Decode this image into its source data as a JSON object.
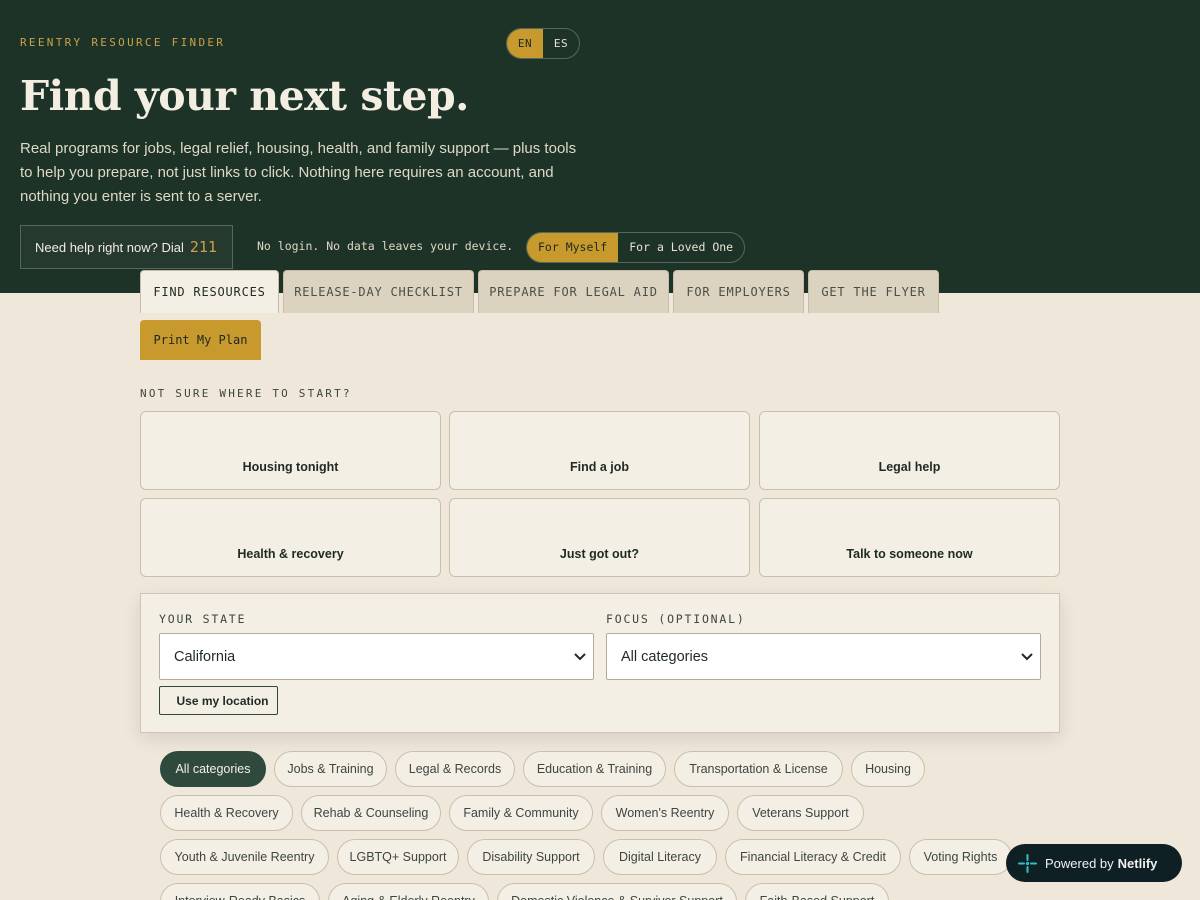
{
  "brand": "REENTRY RESOURCE FINDER",
  "languages": [
    {
      "label": "EN",
      "active": true
    },
    {
      "label": "ES",
      "active": false
    }
  ],
  "hero": {
    "title": "Find your next step.",
    "lead": "Real programs for jobs, legal relief, housing, health, and family support — plus tools to help you prepare, not just links to click. Nothing here requires an account, and nothing you enter is sent to a server."
  },
  "help": {
    "text": "Need help right now? Dial",
    "number": "211"
  },
  "privacy_note": "No login. No data leaves your device.",
  "audience": [
    {
      "label": "For Myself",
      "active": true
    },
    {
      "label": "For a Loved One",
      "active": false
    }
  ],
  "tabs": [
    {
      "label": "FIND RESOURCES",
      "active": true
    },
    {
      "label": "RELEASE-DAY CHECKLIST",
      "active": false
    },
    {
      "label": "PREPARE FOR LEGAL AID",
      "active": false
    },
    {
      "label": "FOR EMPLOYERS",
      "active": false
    },
    {
      "label": "GET THE FLYER",
      "active": false
    }
  ],
  "print_button": "Print My Plan",
  "start_heading": "NOT SURE WHERE TO START?",
  "quick_cards": [
    "Housing tonight",
    "Find a job",
    "Legal help",
    "Health & recovery",
    "Just got out?",
    "Talk to someone now"
  ],
  "filters": {
    "state_label": "YOUR STATE",
    "state_value": "California",
    "focus_label": "FOCUS (OPTIONAL)",
    "focus_value": "All categories",
    "location_button": "Use my location"
  },
  "categories": [
    {
      "label": "All categories",
      "active": true
    },
    {
      "label": "Jobs & Training"
    },
    {
      "label": "Legal & Records"
    },
    {
      "label": "Education & Training"
    },
    {
      "label": "Transportation & License"
    },
    {
      "label": "Housing"
    },
    {
      "label": "Health & Recovery"
    },
    {
      "label": "Rehab & Counseling"
    },
    {
      "label": "Family & Community"
    },
    {
      "label": "Women's Reentry"
    },
    {
      "label": "Veterans Support"
    },
    {
      "label": "Youth & Juvenile Reentry"
    },
    {
      "label": "LGBTQ+ Support"
    },
    {
      "label": "Disability Support"
    },
    {
      "label": "Digital Literacy"
    },
    {
      "label": "Financial Literacy & Credit"
    },
    {
      "label": "Voting Rights"
    },
    {
      "label": "Interview-Ready Basics"
    },
    {
      "label": "Aging & Elderly Reentry"
    },
    {
      "label": "Domestic Violence & Survivor Support"
    },
    {
      "label": "Faith-Based Support"
    }
  ],
  "netlify": {
    "prefix": "Powered by",
    "name": "Netlify"
  },
  "colors": {
    "hero_bg": "#1d3328",
    "accent": "#c89a2e",
    "page_bg": "#efe7da",
    "card_bg": "#f4efe5",
    "chip_active": "#2f4a3c"
  }
}
